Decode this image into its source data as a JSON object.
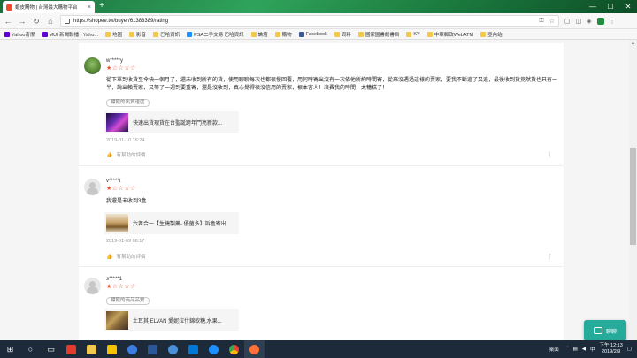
{
  "browser": {
    "tab_title": "蝦皮購物 | 台灣最大購物平台",
    "tab_close": "×",
    "new_tab": "+",
    "url": "https://shopee.tw/buyer/61388389/rating",
    "win_min": "—",
    "win_max": "☐",
    "win_close": "✕"
  },
  "bookmarks": [
    {
      "label": "Yahoo奇摩",
      "icon": "yahoo"
    },
    {
      "label": "MUI 新聞聯播 - Yaho...",
      "icon": "folder"
    },
    {
      "label": "地圖",
      "icon": "folder"
    },
    {
      "label": "影音",
      "icon": "folder"
    },
    {
      "label": "巴哈資訊",
      "icon": "folder"
    },
    {
      "label": "PSA二手交易 巴哈資訊",
      "icon": "psa"
    },
    {
      "label": "論壇",
      "icon": "folder"
    },
    {
      "label": "購物",
      "icon": "folder"
    },
    {
      "label": "Facebook",
      "icon": "fb"
    },
    {
      "label": "資料",
      "icon": "folder"
    },
    {
      "label": "國家圖書館書目",
      "icon": "folder"
    },
    {
      "label": "KY",
      "icon": "folder"
    },
    {
      "label": "中華郵政WebATM",
      "icon": "folder"
    },
    {
      "label": "亞內站",
      "icon": "folder"
    }
  ],
  "reviews": [
    {
      "username": "w*****y",
      "stars": "★☆☆☆☆",
      "comment": "從下單到收貨至今快一個月了，還未收到所有的貨，使用聊聊每次也都很慢回覆，用何時寄出沒有一次依他所約時間寄，從來沒遇過這樣的賣家，要我不斷追了又追，最後收到貨竟然貨也只有一半，說出賴賣家，又等了一週到要重寄，還是沒收到，真心覺得很沒信用的賣家，根本害人！浪費我的時間，太糟糕了！",
      "tag": "標籤的出貨速度",
      "product_name": "快速出貨現貨在台聖誕跨年鬥亮新款...",
      "datetime": "2019-01-10 16:24",
      "helpful": "有幫助的評價"
    },
    {
      "username": "v*****t",
      "stars": "★☆☆☆☆",
      "comment": "我還是未收到3盒",
      "tag": "",
      "product_name": "六酋合一【生捷製藥- 優菌多】訴盒寄出",
      "datetime": "2019-01-09 08:17",
      "helpful": "有幫助的評價"
    },
    {
      "username": "s*****1",
      "stars": "★☆☆☆☆",
      "comment": "",
      "tag": "標籤的商品品質",
      "product_name": "土耳其 ELVAN 愛妮拉什錦軟糖,水果...",
      "datetime": "",
      "helpful": ""
    }
  ],
  "chat": {
    "label": "聊聊"
  },
  "taskbar": {
    "desktop_label": "桌面",
    "time": "下午 12:13",
    "date": "2019/2/9"
  }
}
